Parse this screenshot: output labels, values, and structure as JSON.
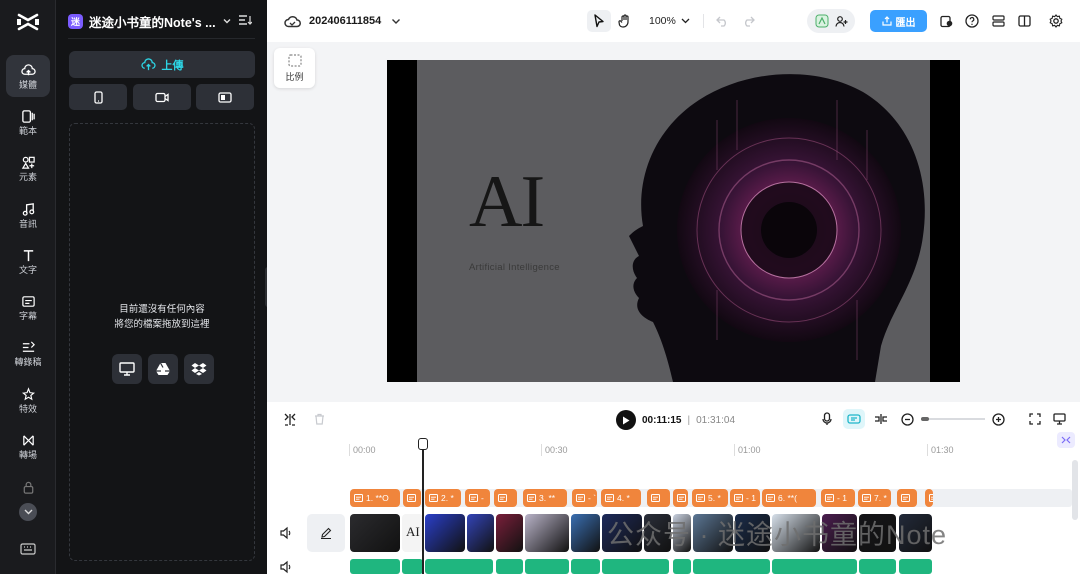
{
  "rail": {
    "items": [
      {
        "label": "媒體",
        "icon": "cloud-upload-icon"
      },
      {
        "label": "範本",
        "icon": "template-icon"
      },
      {
        "label": "元素",
        "icon": "elements-icon"
      },
      {
        "label": "音訊",
        "icon": "music-note-icon"
      },
      {
        "label": "文字",
        "icon": "text-icon"
      },
      {
        "label": "字幕",
        "icon": "captions-icon"
      },
      {
        "label": "轉錄稿",
        "icon": "transcript-icon"
      },
      {
        "label": "特效",
        "icon": "effects-icon"
      },
      {
        "label": "轉場",
        "icon": "transition-icon"
      }
    ]
  },
  "panel": {
    "project_avatar": "迷",
    "project_name": "迷途小书童的Note's ...",
    "upload_label": "上傳",
    "empty_line1": "目前還沒有任何內容",
    "empty_line2": "將您的檔案拖放到這裡"
  },
  "topbar": {
    "project_title": "202406111854",
    "zoom": "100%",
    "export_label": "匯出"
  },
  "canvas": {
    "ratio_label": "比例",
    "preview_title": "AI",
    "preview_subtitle": "Artificial Intelligence"
  },
  "timeline": {
    "current_time": "00:11:15",
    "separator": "|",
    "total_time": "01:31:04",
    "ruler": [
      "00:00",
      "00:30",
      "01:00",
      "01:30"
    ],
    "captions": [
      "1. **O",
      "",
      "2. *",
      "-",
      "",
      "3. **",
      "- `",
      "4. *",
      "",
      "",
      "5. *",
      "- 1",
      "6. **(",
      "- 1",
      "7. *",
      "",
      ""
    ],
    "clip_text": "AI",
    "watermark": "公众号 · 迷途小书童的Note"
  },
  "colors": {
    "accent": "#2dd4e4",
    "export": "#3aa0ff",
    "caption": "#f0853c",
    "audio": "#1fb67f",
    "project_avatar": "#7b5cff"
  }
}
